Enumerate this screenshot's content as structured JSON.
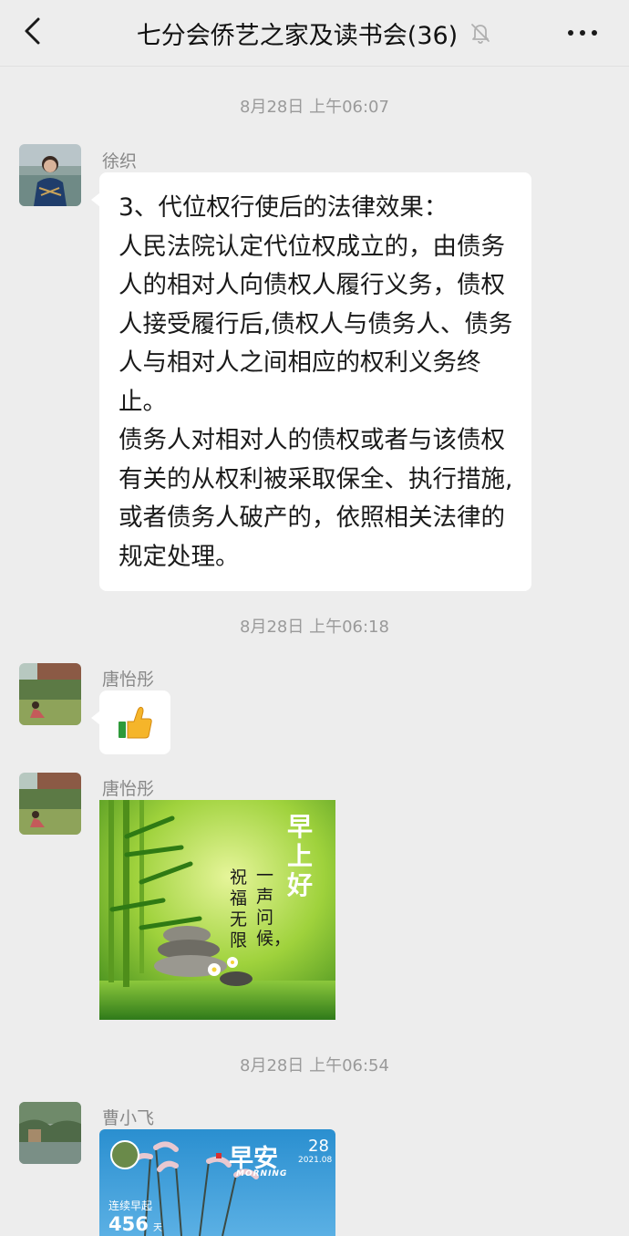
{
  "header": {
    "title": "七分会侨艺之家及读书会(36)",
    "back_icon": "chevron-left-icon",
    "mute_icon": "bell-off-icon",
    "more_icon": "more-dots-icon"
  },
  "messages": {
    "ts1": "8月28日 上午06:07",
    "m1": {
      "sender": "徐织",
      "text": "3、代位权行使后的法律效果：\n人民法院认定代位权成立的，由债务人的相对人向债权人履行义务，债权人接受履行后,债权人与债务人、债务人与相对人之间相应的权利义务终止。\n债务人对相对人的债权或者与该债权有关的从权利被采取保全、执行措施,或者债务人破产的，依照相关法律的规定处理。"
    },
    "ts2": "8月28日 上午06:18",
    "m2": {
      "sender": "唐怡彤",
      "emoji": "👍"
    },
    "m3": {
      "sender": "唐怡彤",
      "image": {
        "title_chars": [
          "早",
          "上",
          "好"
        ],
        "line1": "一声问候，",
        "line2": "祝福无限"
      }
    },
    "ts3": "8月28日 上午06:54",
    "m4": {
      "sender": "曹小飞",
      "card": {
        "title": "早安",
        "subtitle": "MORNING",
        "day": "28",
        "date": "2021.08",
        "streak_label": "连续早起",
        "streak_count": "456",
        "streak_unit": "天"
      }
    }
  },
  "colors": {
    "background": "#ededed",
    "bubble": "#ffffff",
    "timestamp": "#9a9a9a",
    "sender": "#888888"
  }
}
